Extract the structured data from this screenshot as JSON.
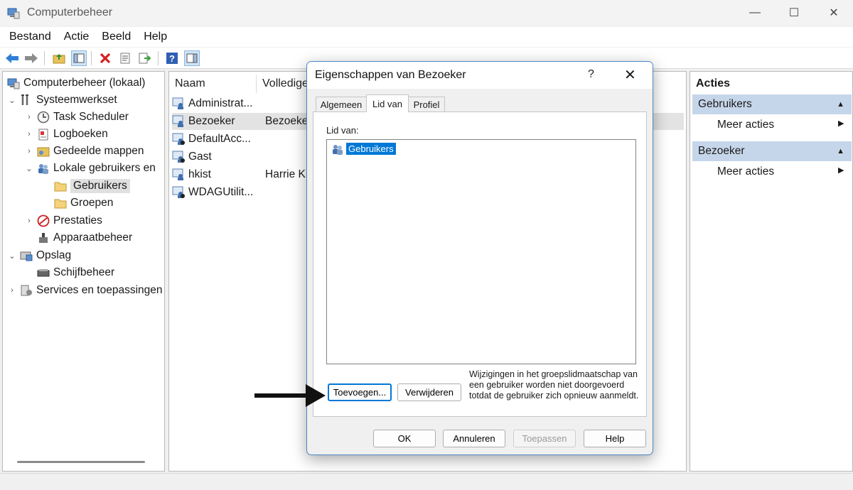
{
  "window": {
    "title": "Computerbeheer",
    "minimize": "—",
    "maximize": "☐",
    "close": "✕"
  },
  "menu": [
    "Bestand",
    "Actie",
    "Beeld",
    "Help"
  ],
  "tree": {
    "root": "Computerbeheer (lokaal)",
    "systeem": "Systeemwerkset",
    "task": "Task Scheduler",
    "logboeken": "Logboeken",
    "gedeelde": "Gedeelde mappen",
    "lokale": "Lokale gebruikers en",
    "gebruikers": "Gebruikers",
    "groepen": "Groepen",
    "prestaties": "Prestaties",
    "apparaat": "Apparaatbeheer",
    "opslag": "Opslag",
    "schijf": "Schijfbeheer",
    "services": "Services en toepassingen"
  },
  "list": {
    "col_name": "Naam",
    "col_full": "Volledige",
    "rows": [
      {
        "name": "Administrat...",
        "full": ""
      },
      {
        "name": "Bezoeker",
        "full": "Bezoeker"
      },
      {
        "name": "DefaultAcc...",
        "full": ""
      },
      {
        "name": "Gast",
        "full": ""
      },
      {
        "name": "hkist",
        "full": "Harrie Ki"
      },
      {
        "name": "WDAGUtilit...",
        "full": ""
      }
    ]
  },
  "actions": {
    "title": "Acties",
    "group1": "Gebruikers",
    "group1_item": "Meer acties",
    "group2": "Bezoeker",
    "group2_item": "Meer acties"
  },
  "dialog": {
    "title": "Eigenschappen van Bezoeker",
    "help": "?",
    "close": "✕",
    "tabs": [
      "Algemeen",
      "Lid van",
      "Profiel"
    ],
    "member_label": "Lid van:",
    "members": [
      "Gebruikers"
    ],
    "add_button": "Toevoegen...",
    "remove_button": "Verwijderen",
    "note": "Wijzigingen in het groepslidmaatschap van een gebruiker worden niet doorgevoerd totdat de gebruiker zich opnieuw aanmeldt.",
    "ok": "OK",
    "cancel": "Annuleren",
    "apply": "Toepassen",
    "help_button": "Help"
  }
}
